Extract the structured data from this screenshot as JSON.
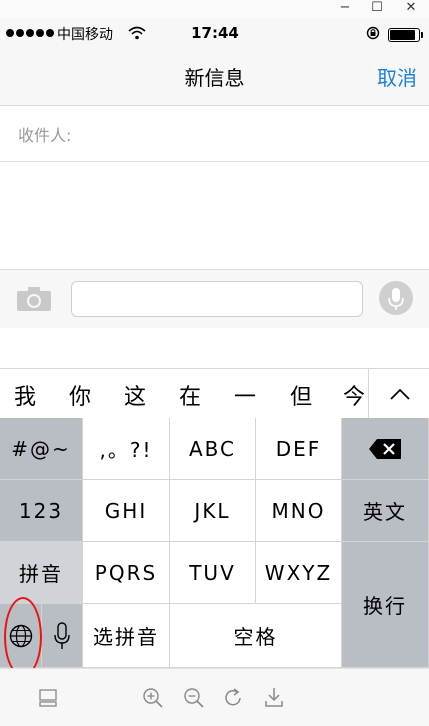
{
  "window": {
    "minimize_icon": "minus",
    "maximize_icon": "square",
    "close_icon": "x"
  },
  "status_bar": {
    "carrier": "中国移动",
    "time": "17:44",
    "signal_dots": 5
  },
  "nav": {
    "title": "新信息",
    "cancel": "取消"
  },
  "recipients": {
    "label": "收件人:"
  },
  "compose": {
    "camera_icon": "camera-icon",
    "mic_icon": "mic-icon"
  },
  "candidates": {
    "items": [
      "我",
      "你",
      "这",
      "在",
      "一",
      "但",
      "今"
    ],
    "expand": "^"
  },
  "keyboard": {
    "symbols": "#@~",
    "punct": ",。?!",
    "abc": "ABC",
    "def": "DEF",
    "backspace_icon": "backspace-icon",
    "num": "123",
    "ghi": "GHI",
    "jkl": "JKL",
    "mno": "MNO",
    "english": "英文",
    "pinyin": "拼音",
    "pqrs": "PQRS",
    "tuv": "TUV",
    "wxyz": "WXYZ",
    "newline": "换行",
    "globe_icon": "globe-icon",
    "mic_icon": "mic-icon",
    "select_pinyin": "选拼音",
    "space": "空格"
  },
  "toolbar_icons": [
    "keyboard-icon",
    "zoom-in-icon",
    "zoom-out-icon",
    "refresh-icon",
    "download-icon"
  ],
  "colors": {
    "accent": "#1a7fd8",
    "annotation": "#e11111",
    "key_gray": "#b9bdc4"
  }
}
